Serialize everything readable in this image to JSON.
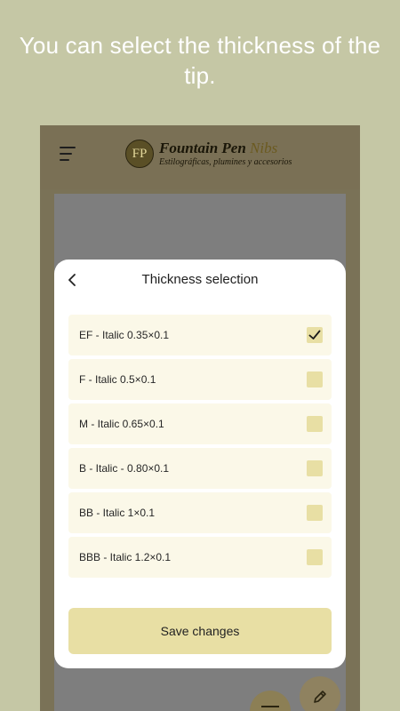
{
  "caption": "You can select the thickness of the tip.",
  "app": {
    "logo_initials": "FP",
    "logo_title_main": "Fountain Pen ",
    "logo_title_accent": "Nibs",
    "logo_subtitle": "Estilográficas, plumines y accesorios",
    "menu_icon": "hamburger-menu-icon",
    "fab_icons": [
      "list-icon",
      "pencil-icon"
    ]
  },
  "modal": {
    "title": "Thickness selection",
    "back_icon": "chevron-left-icon",
    "options": [
      {
        "label": "EF - Italic 0.35×0.1",
        "checked": true
      },
      {
        "label": "F - Italic 0.5×0.1",
        "checked": false
      },
      {
        "label": "M - Italic 0.65×0.1",
        "checked": false
      },
      {
        "label": "B - Italic - 0.80×0.1",
        "checked": false
      },
      {
        "label": "BB - Italic 1×0.1",
        "checked": false
      },
      {
        "label": "BBB - Italic 1.2×0.1",
        "checked": false
      }
    ],
    "save_label": "Save changes"
  },
  "colors": {
    "background": "#c5c7a5",
    "accent": "#e8dfa4",
    "option_bg": "#fbf8e8"
  }
}
